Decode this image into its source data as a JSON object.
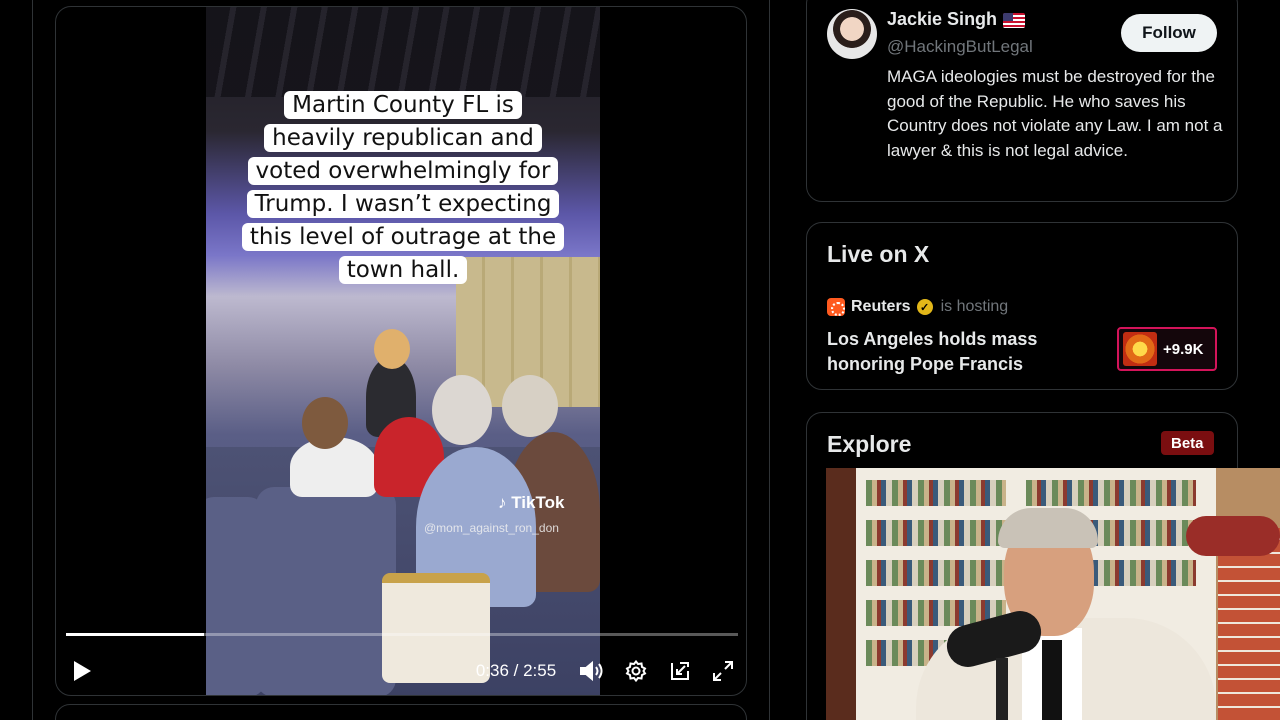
{
  "video": {
    "caption_lines": [
      "Martin County FL is",
      "heavily republican and",
      "voted overwhelmingly for",
      "Trump. I wasn’t expecting",
      "this level of outrage at the",
      "town hall."
    ],
    "watermark": "TikTok",
    "watermark_user": "@mom_against_ron_don",
    "time_display": "0:36 / 2:55",
    "progress_fraction": 0.206
  },
  "who_to_follow": {
    "name": "Jackie Singh",
    "flag_icon": "us-flag-icon",
    "handle": "@HackingButLegal",
    "follow_label": "Follow",
    "bio": "MAGA ideologies must be destroyed for the good of the Republic. He who saves his Country does not violate any Law. I am not a lawyer & this is not legal advice."
  },
  "live": {
    "title": "Live on X",
    "host": "Reuters",
    "host_suffix": "is hosting",
    "headline": "Los Angeles holds mass honoring Pope Francis",
    "listeners": "+9.9K"
  },
  "explore": {
    "title": "Explore",
    "badge": "Beta"
  },
  "colors": {
    "background": "#000000",
    "border": "#2f3336",
    "text_primary": "#e7e9ea",
    "text_secondary": "#71767b",
    "live_accent": "#d4145a",
    "beta_badge": "#7a0e10"
  }
}
